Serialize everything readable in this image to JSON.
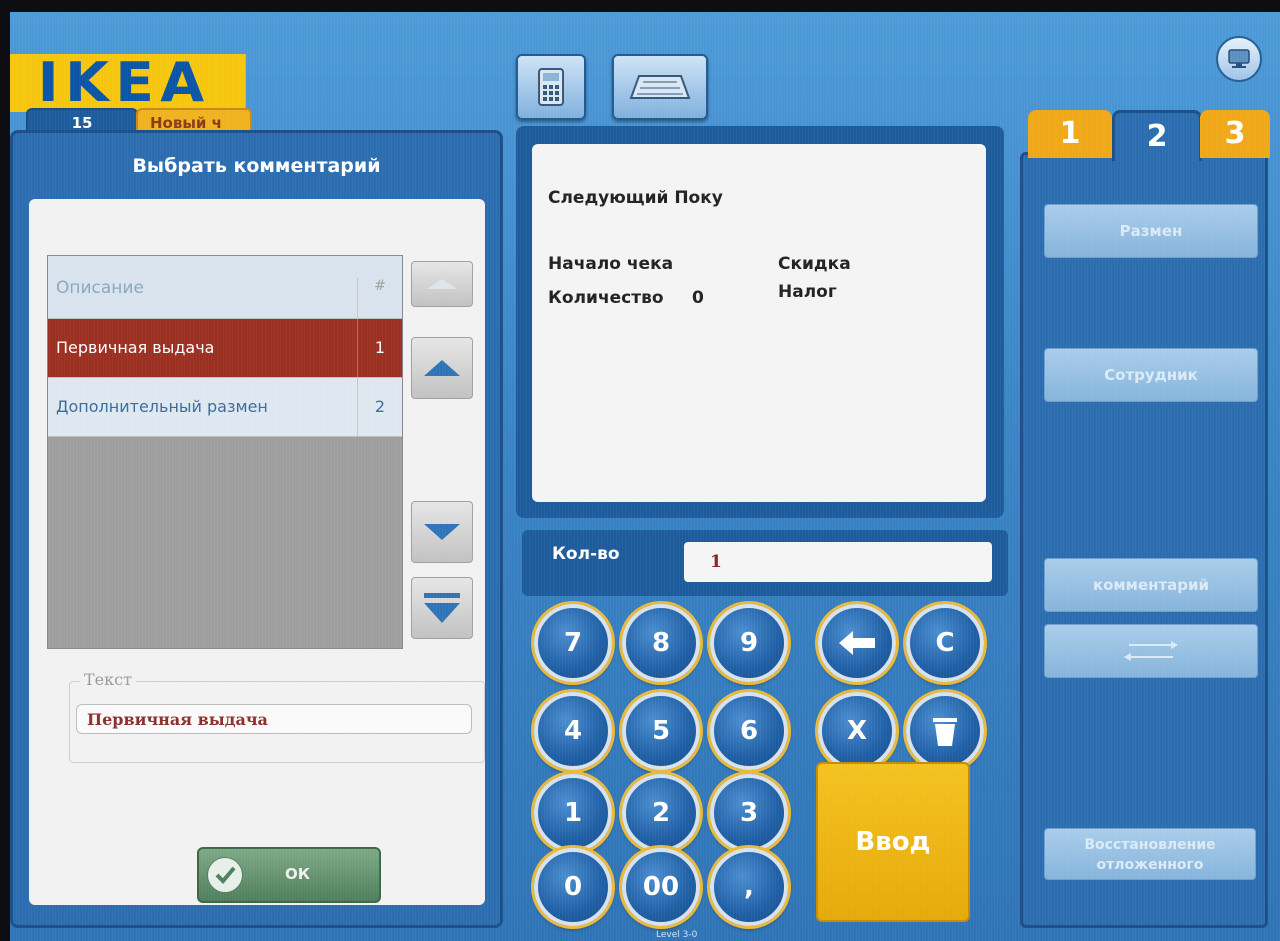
{
  "header": {
    "logo": "IKEA",
    "tab_order": "15",
    "tab_new": "Новый ч"
  },
  "comment_panel": {
    "title": "Выбрать комментарий",
    "columns": [
      "Описание",
      "#"
    ],
    "rows": [
      {
        "description": "Первичная выдача",
        "number": "1",
        "selected": true
      },
      {
        "description": "Дополнительный размен",
        "number": "2",
        "selected": false
      }
    ],
    "text_label": "Текст",
    "text_value": "Первичная выдача",
    "ok_label": "ОК"
  },
  "receipt": {
    "next_customer": "Следующий Поку",
    "receipt_start": "Начало чека",
    "discount": "Скидка",
    "quantity_label": "Количество",
    "quantity_value": "0",
    "tax": "Налог"
  },
  "quantity": {
    "label": "Кол-во",
    "value": "1"
  },
  "keypad": {
    "k7": "7",
    "k8": "8",
    "k9": "9",
    "k4": "4",
    "k5": "5",
    "k6": "6",
    "k1": "1",
    "k2": "2",
    "k3": "3",
    "k0": "0",
    "k00": "00",
    "kcomma": ",",
    "clear": "C",
    "multiply": "X",
    "enter": "Ввод"
  },
  "right_panel": {
    "tabs": [
      "1",
      "2",
      "3"
    ],
    "active_tab": "2",
    "buttons": {
      "change": "Размен",
      "employee": "Сотрудник",
      "comment": "комментарий",
      "restore": "Восстановление отложенного"
    }
  },
  "footer": {
    "level": "Level 3-0"
  },
  "colors": {
    "accent_yellow": "#f4c21f",
    "selected_row": "#9b2f22",
    "brand_blue": "#2c6db0"
  }
}
